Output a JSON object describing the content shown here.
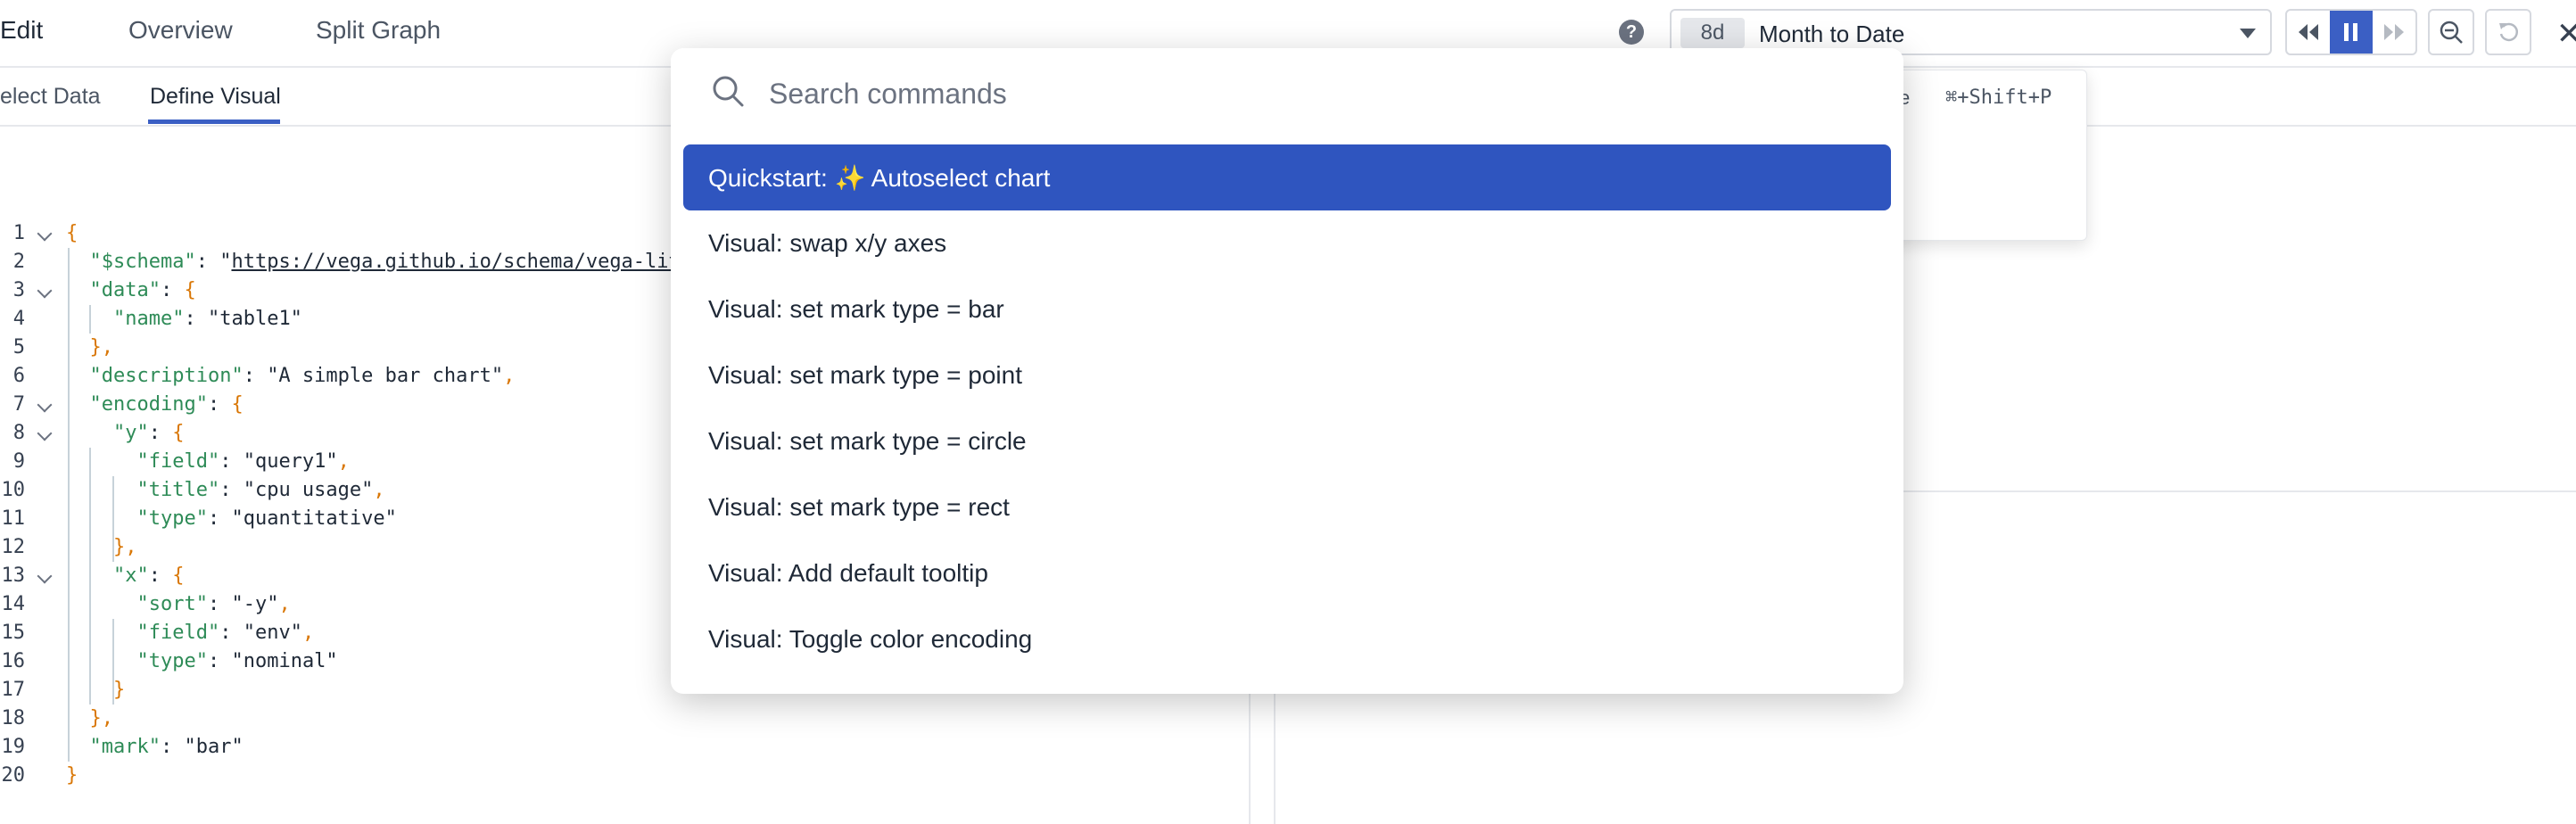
{
  "top_tabs": [
    "Edit",
    "Overview",
    "Split Graph"
  ],
  "time_range": {
    "badge": "8d",
    "label": "Month to Date"
  },
  "sub_tabs": [
    "elect Data",
    "Define Visual"
  ],
  "shortcut": {
    "prefix": "e",
    "keys": "⌘+Shift+P"
  },
  "editor": {
    "line_numbers": [
      "1",
      "2",
      "3",
      "4",
      "5",
      "6",
      "7",
      "8",
      "9",
      "10",
      "11",
      "12",
      "13",
      "14",
      "15",
      "16",
      "17",
      "18",
      "19",
      "20"
    ],
    "schema_key": "\"$schema\"",
    "schema_val": "https://vega.github.io/schema/vega-lit",
    "data_key": "\"data\"",
    "name_key": "\"name\"",
    "name_val": "\"table1\"",
    "description_key": "\"description\"",
    "description_val": "\"A simple bar chart\"",
    "encoding_key": "\"encoding\"",
    "y_key": "\"y\"",
    "field_key": "\"field\"",
    "field_y_val": "\"query1\"",
    "title_key": "\"title\"",
    "title_val": "\"cpu usage\"",
    "type_key": "\"type\"",
    "type_y_val": "\"quantitative\"",
    "x_key": "\"x\"",
    "sort_key": "\"sort\"",
    "sort_val": "\"-y\"",
    "field_x_val": "\"env\"",
    "type_x_val": "\"nominal\"",
    "mark_key": "\"mark\"",
    "mark_val": "\"bar\""
  },
  "palette": {
    "placeholder": "Search commands",
    "commands": [
      "Quickstart: ✨ Autoselect chart",
      "Visual: swap x/y axes",
      "Visual: set mark type = bar",
      "Visual: set mark type = point",
      "Visual: set mark type = circle",
      "Visual: set mark type = rect",
      "Visual: Add default tooltip",
      "Visual: Toggle color encoding"
    ]
  },
  "colors": {
    "accent": "#2f55bf",
    "key_green": "#2e8b57",
    "punct_orange": "#d97706"
  },
  "icons": [
    "help-icon",
    "chevron-down-icon",
    "rewind-icon",
    "pause-icon",
    "fast-forward-icon",
    "zoom-out-icon",
    "reset-icon",
    "close-icon",
    "search-icon"
  ]
}
